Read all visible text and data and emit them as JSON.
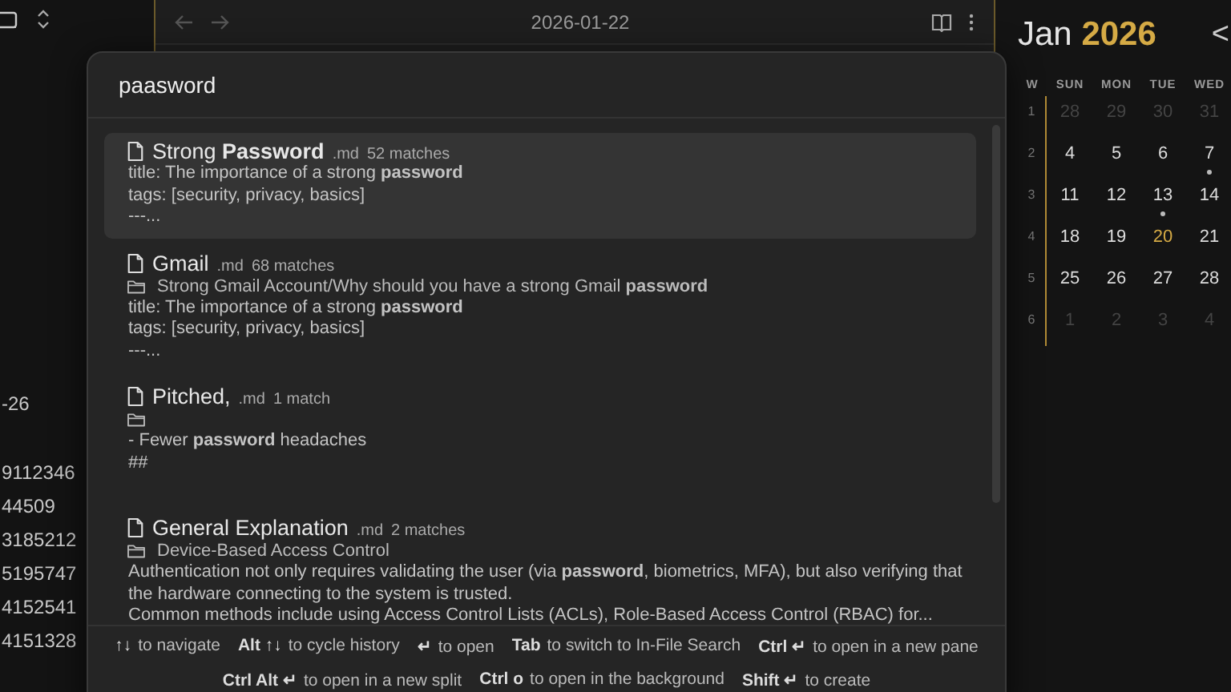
{
  "sidebar": {
    "items": [
      "-26",
      "9112346",
      "44509",
      "3185212",
      "5195747",
      "4152541",
      "4151328"
    ]
  },
  "header": {
    "title": "2026-01-22"
  },
  "search": {
    "value": "paasword",
    "results": [
      {
        "title": "Strong **Password**",
        "ext": ".md",
        "matches": "52 matches",
        "selected": true,
        "show_folder": false,
        "lines": [
          "title: The importance of a strong **password**",
          "tags: [security, privacy, basics]",
          "---..."
        ]
      },
      {
        "title": "Gmail",
        "ext": ".md",
        "matches": "68 matches",
        "selected": false,
        "show_folder": true,
        "path": "Strong Gmail Account/Why should you have a strong Gmail **password**",
        "lines": [
          "title: The importance of a strong **password**",
          "tags: [security, privacy, basics]",
          "---..."
        ]
      },
      {
        "title": "Pitched,",
        "ext": ".md",
        "matches": "1 match",
        "selected": false,
        "show_folder": true,
        "lines": [
          "- Fewer **password** headaches",
          "##"
        ]
      },
      {
        "title": "General Explanation",
        "ext": ".md",
        "matches": "2 matches",
        "selected": false,
        "show_folder": true,
        "path": "Device-Based Access Control",
        "lines": [
          "Authentication not only requires validating the user (via **password**, biometrics, MFA), but also verifying that the hardware connecting to the system is trusted.",
          "Common methods include using Access Control Lists (ACLs), Role-Based Access Control (RBAC) for..."
        ]
      }
    ],
    "hints": [
      {
        "key": "↑↓",
        "text": "to navigate"
      },
      {
        "key": "Alt ↑↓",
        "text": "to cycle history"
      },
      {
        "key": "↵",
        "text": "to open"
      },
      {
        "key": "Tab",
        "text": "to switch to In-File Search"
      },
      {
        "key": "Ctrl ↵",
        "text": "to open in a new pane"
      },
      {
        "key": "Ctrl Alt ↵",
        "text": "to open in a new split"
      },
      {
        "key": "Ctrl o",
        "text": "to open in the background"
      },
      {
        "key": "Shift ↵",
        "text": "to create"
      }
    ]
  },
  "calendar": {
    "month": "Jan",
    "year": "2026",
    "nav": "<",
    "week_label": "W",
    "weekdays": [
      "SUN",
      "MON",
      "TUE",
      "WED"
    ],
    "weeks": [
      {
        "number": "1",
        "days": [
          {
            "label": "28",
            "muted": true,
            "today": false,
            "dot": false
          },
          {
            "label": "29",
            "muted": true,
            "today": false,
            "dot": false
          },
          {
            "label": "30",
            "muted": true,
            "today": false,
            "dot": false
          },
          {
            "label": "31",
            "muted": true,
            "today": false,
            "dot": false
          }
        ]
      },
      {
        "number": "2",
        "days": [
          {
            "label": "4",
            "muted": false,
            "today": false,
            "dot": false
          },
          {
            "label": "5",
            "muted": false,
            "today": false,
            "dot": false
          },
          {
            "label": "6",
            "muted": false,
            "today": false,
            "dot": false
          },
          {
            "label": "7",
            "muted": false,
            "today": false,
            "dot": true
          }
        ]
      },
      {
        "number": "3",
        "days": [
          {
            "label": "11",
            "muted": false,
            "today": false,
            "dot": false
          },
          {
            "label": "12",
            "muted": false,
            "today": false,
            "dot": false
          },
          {
            "label": "13",
            "muted": false,
            "today": false,
            "dot": true
          },
          {
            "label": "14",
            "muted": false,
            "today": false,
            "dot": false
          }
        ]
      },
      {
        "number": "4",
        "days": [
          {
            "label": "18",
            "muted": false,
            "today": false,
            "dot": false
          },
          {
            "label": "19",
            "muted": false,
            "today": false,
            "dot": false
          },
          {
            "label": "20",
            "muted": false,
            "today": true,
            "dot": false
          },
          {
            "label": "21",
            "muted": false,
            "today": false,
            "dot": false
          }
        ]
      },
      {
        "number": "5",
        "days": [
          {
            "label": "25",
            "muted": false,
            "today": false,
            "dot": false
          },
          {
            "label": "26",
            "muted": false,
            "today": false,
            "dot": false
          },
          {
            "label": "27",
            "muted": false,
            "today": false,
            "dot": false
          },
          {
            "label": "28",
            "muted": false,
            "today": false,
            "dot": false
          }
        ]
      },
      {
        "number": "6",
        "days": [
          {
            "label": "1",
            "muted": true,
            "today": false,
            "dot": false
          },
          {
            "label": "2",
            "muted": true,
            "today": false,
            "dot": false
          },
          {
            "label": "3",
            "muted": true,
            "today": false,
            "dot": false
          },
          {
            "label": "4",
            "muted": true,
            "today": false,
            "dot": false
          }
        ]
      }
    ]
  }
}
